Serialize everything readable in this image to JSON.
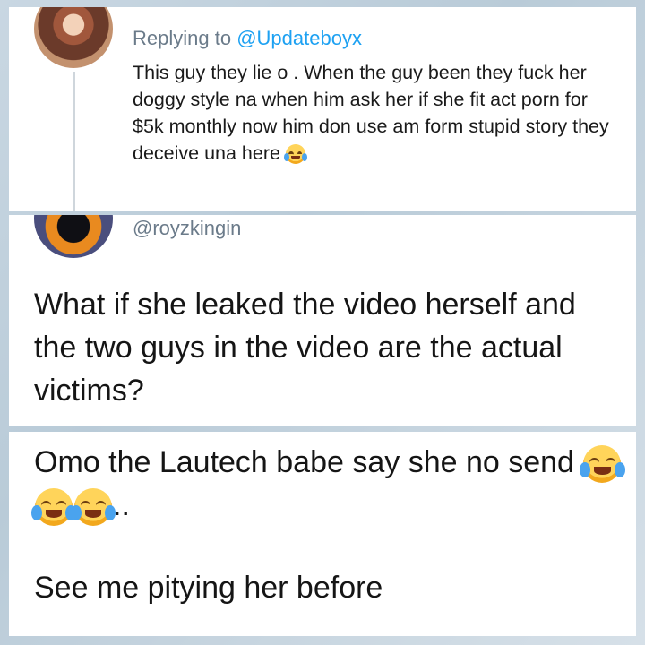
{
  "reply_card": {
    "replying_prefix": "Replying to",
    "replying_handle": "@Updateboyx",
    "tweet_text": "This guy they lie o . When the guy been they fuck her doggy style na when him ask her if she fit act porn for $5k monthly now him don use am form stupid story they deceive una here",
    "emoji_icon": "face-with-tears-of-joy"
  },
  "royz_card": {
    "handle": "@royzkingin",
    "tweet_text": "What if she leaked the video herself and the two guys in the video are the actual victims?"
  },
  "omo_card": {
    "line1": "Omo the Lautech babe say she no send",
    "line1_suffix": "..",
    "line2": "See me pitying her before",
    "emoji_icon": "face-with-tears-of-joy",
    "emoji_count": 3
  }
}
